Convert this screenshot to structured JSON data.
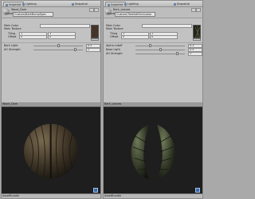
{
  "left": {
    "tabs": {
      "inspector": "Inspector",
      "lighting": "Lighting",
      "second": "Snapshot"
    },
    "material_name": "Wood_Dark",
    "shader_label": "Shader",
    "shader_value": "Custom/BarkBumpSpec",
    "main_color_label": "Main Color",
    "main_texture_label": "Main Texture",
    "tiling_label": "Tiling",
    "offset_label": "Offset",
    "tiling_x": "1",
    "tiling_y": "1",
    "offset_x": "0",
    "offset_y": "0",
    "slider1_label": "Bark Light",
    "slider1_value": "0.5",
    "slider2_label": "AO Strength",
    "slider2_value": "1",
    "slider1_fraction": 0.5,
    "slider2_fraction": 0.85,
    "preview_label": "Wood_Dark",
    "preview_bottom_label": "AssetBundle"
  },
  "right": {
    "tabs": {
      "inspector": "Inspector",
      "lighting": "Lighting",
      "second": "Snapshot"
    },
    "material_name": "Bark_Leaves",
    "shader_label": "Shader",
    "shader_value": "Custom/TreeSoftOcclusion",
    "main_color_label": "Main Color",
    "main_texture_label": "Main Texture",
    "tiling_label": "Tiling",
    "offset_label": "Offset",
    "tiling_x": "1",
    "tiling_y": "1",
    "offset_x": "0",
    "offset_y": "0",
    "slider1_label": "Alpha cutoff",
    "slider1_value": "0.3",
    "slider2_label": "Base Light",
    "slider2_value": "0.5",
    "slider3_label": "AO Strength",
    "slider3_value": "1",
    "slider1_fraction": 0.3,
    "slider2_fraction": 0.5,
    "slider3_fraction": 0.85,
    "preview_label": "Bark_Leaves",
    "preview_bottom_label": "AssetBundle"
  }
}
